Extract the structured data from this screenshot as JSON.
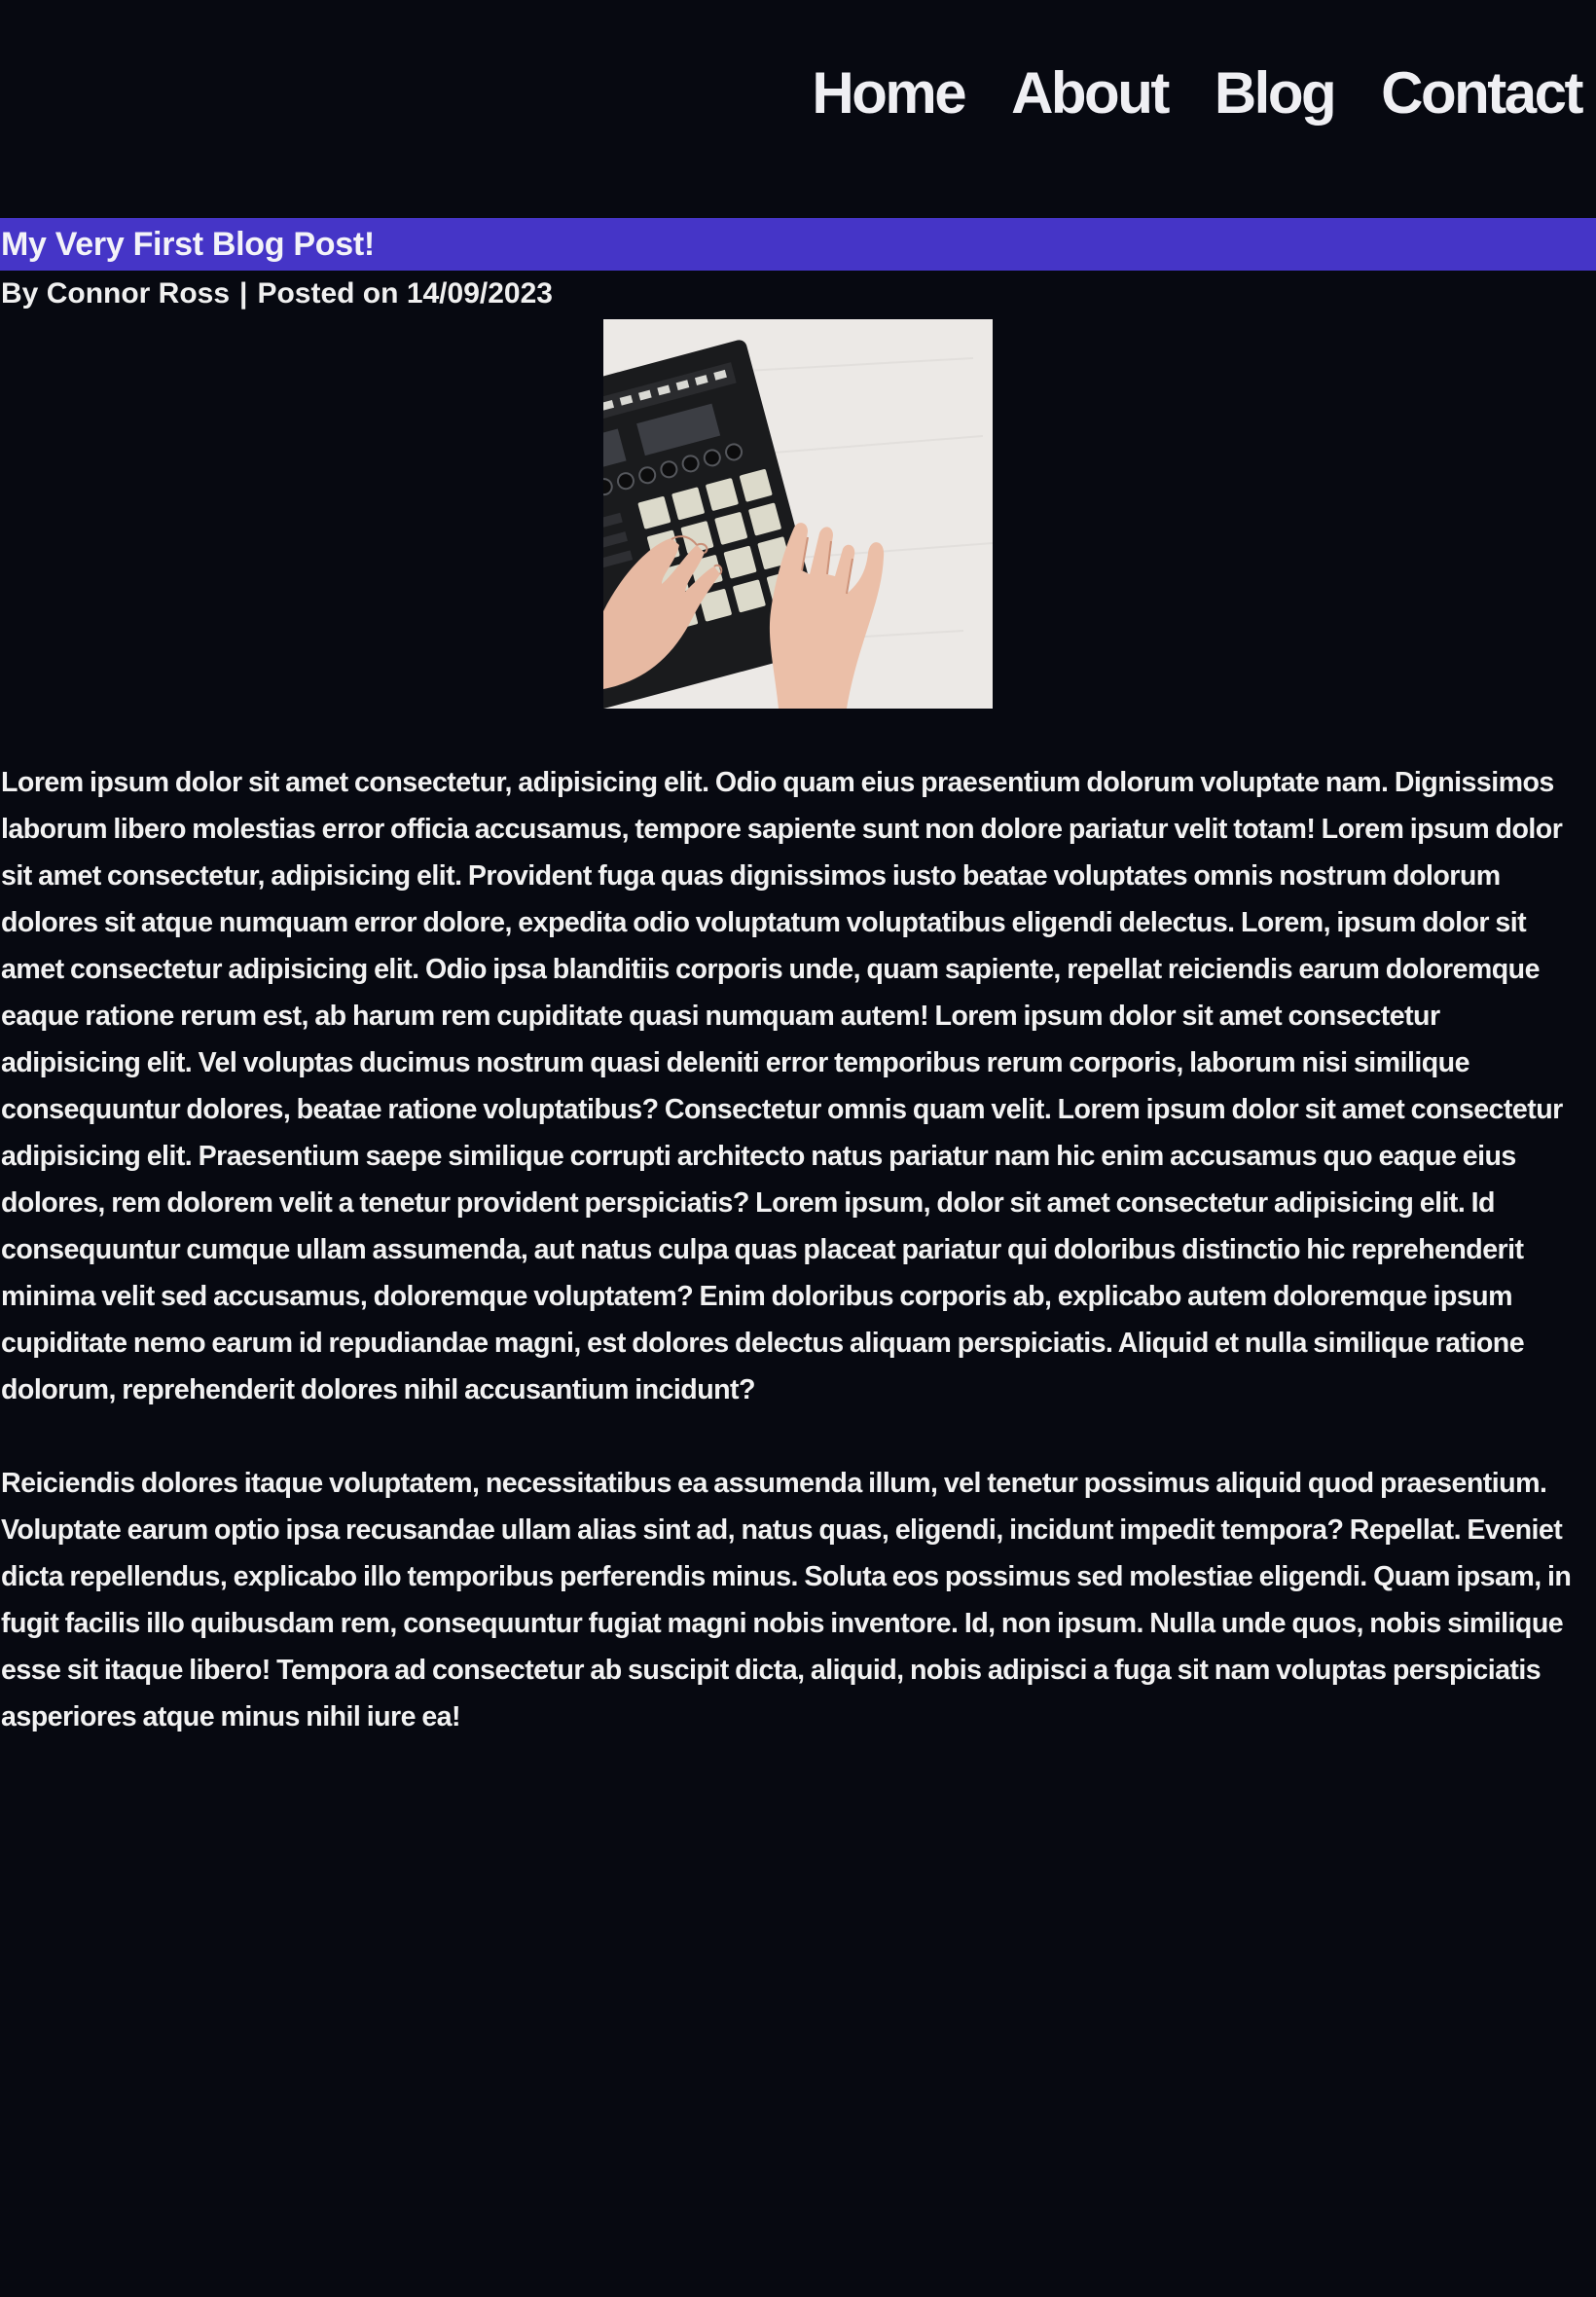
{
  "nav": {
    "items": [
      {
        "label": "Home"
      },
      {
        "label": "About"
      },
      {
        "label": "Blog"
      },
      {
        "label": "Contact"
      }
    ]
  },
  "post": {
    "title": "My Very First Blog Post!",
    "author_prefix": "By",
    "author": "Connor Ross",
    "separator": "|",
    "posted_prefix": "Posted on",
    "date": "14/09/2023",
    "image_alt": "Hands playing a drum pad controller",
    "paragraphs": [
      "Lorem ipsum dolor sit amet consectetur, adipisicing elit. Odio quam eius praesentium dolorum voluptate nam. Dignissimos laborum libero molestias error officia accusamus, tempore sapiente sunt non dolore pariatur velit totam! Lorem ipsum dolor sit amet consectetur, adipisicing elit. Provident fuga quas dignissimos iusto beatae voluptates omnis nostrum dolorum dolores sit atque numquam error dolore, expedita odio voluptatum voluptatibus eligendi delectus. Lorem, ipsum dolor sit amet consectetur adipisicing elit. Odio ipsa blanditiis corporis unde, quam sapiente, repellat reiciendis earum doloremque eaque ratione rerum est, ab harum rem cupiditate quasi numquam autem! Lorem ipsum dolor sit amet consectetur adipisicing elit. Vel voluptas ducimus nostrum quasi deleniti error temporibus rerum corporis, laborum nisi similique consequuntur dolores, beatae ratione voluptatibus? Consectetur omnis quam velit. Lorem ipsum dolor sit amet consectetur adipisicing elit. Praesentium saepe similique corrupti architecto natus pariatur nam hic enim accusamus quo eaque eius dolores, rem dolorem velit a tenetur provident perspiciatis? Lorem ipsum, dolor sit amet consectetur adipisicing elit. Id consequuntur cumque ullam assumenda, aut natus culpa quas placeat pariatur qui doloribus distinctio hic reprehenderit minima velit sed accusamus, doloremque voluptatem? Enim doloribus corporis ab, explicabo autem doloremque ipsum cupiditate nemo earum id repudiandae magni, est dolores delectus aliquam perspiciatis. Aliquid et nulla similique ratione dolorum, reprehenderit dolores nihil accusantium incidunt?",
      "Reiciendis dolores itaque voluptatem, necessitatibus ea assumenda illum, vel tenetur possimus aliquid quod praesentium. Voluptate earum optio ipsa recusandae ullam alias sint ad, natus quas, eligendi, incidunt impedit tempora? Repellat. Eveniet dicta repellendus, explicabo illo temporibus perferendis minus. Soluta eos possimus sed molestiae eligendi. Quam ipsam, in fugit facilis illo quibusdam rem, consequuntur fugiat magni nobis inventore. Id, non ipsum. Nulla unde quos, nobis similique esse sit itaque libero! Tempora ad consectetur ab suscipit dicta, aliquid, nobis adipisci a fuga sit nam voluptas perspiciatis asperiores atque minus nihil iure ea!"
    ]
  },
  "colors": {
    "background": "#070911",
    "title_bar": "#4535c7",
    "text": "#f1f1f1"
  }
}
